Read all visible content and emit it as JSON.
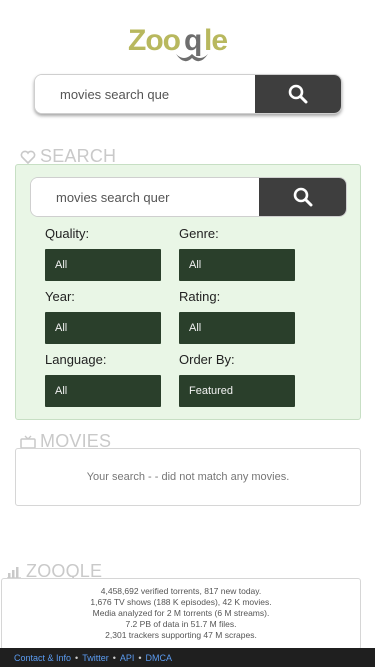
{
  "brand": {
    "name": "Zooqle",
    "logo_text_color": "#b8b85e",
    "logo_accent_color": "#6e6e6e"
  },
  "top_search": {
    "value": "movies search que",
    "button_icon": "search-icon"
  },
  "search_section": {
    "heading": "SEARCH",
    "icon": "heart-icon",
    "query_value": "movies search quer",
    "fields": {
      "quality": {
        "label": "Quality:",
        "value": "All"
      },
      "genre": {
        "label": "Genre:",
        "value": "All"
      },
      "year": {
        "label": "Year:",
        "value": "All"
      },
      "rating": {
        "label": "Rating:",
        "value": "All"
      },
      "language": {
        "label": "Language:",
        "value": "All"
      },
      "order_by": {
        "label": "Order By:",
        "value": "Featured"
      }
    }
  },
  "movies_section": {
    "heading": "MOVIES",
    "icon": "tv-icon",
    "empty_message": "Your search - - did not match any movies."
  },
  "zooqle_section": {
    "heading": "ZOOQLE",
    "icon": "chart-icon",
    "stats": [
      "4,458,692 verified torrents, 817 new today.",
      "1,676 TV shows (188 K episodes), 42 K movies.",
      "Media analyzed for 2 M torrents (6 M streams).",
      "7.2 PB of data in 51.7 M files.",
      "2,301 trackers  supporting 47 M scrapes."
    ]
  },
  "footer": {
    "links": [
      "Contact & Info",
      "Twitter",
      "API",
      "DMCA"
    ],
    "separator": "•"
  },
  "colors": {
    "panel_bg": "#e9f6e6",
    "select_bg": "#2a3f2b",
    "button_bg": "#3e3e3e",
    "heading_gray": "#c9c9c9",
    "footer_bg": "#1f1f1f",
    "link_blue": "#5b9bf0"
  }
}
